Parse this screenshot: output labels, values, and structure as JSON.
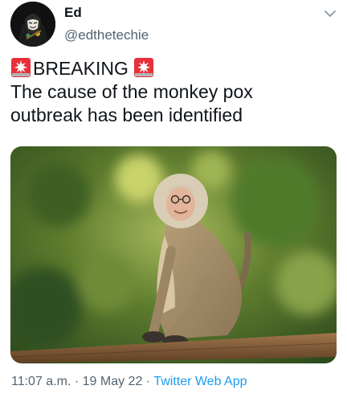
{
  "user": {
    "display_name": "Ed",
    "handle": "@edthetechie"
  },
  "tweet": {
    "line1_text": "BREAKING",
    "line2": "The cause of the monkey pox",
    "line3": "outbreak has been identified",
    "emoji": "police-car-light-emoji"
  },
  "media": {
    "subject": "monkey-photo"
  },
  "meta": {
    "time": "11:07 a.m.",
    "separator1": " · ",
    "date": "19 May 22",
    "separator2": " · ",
    "source": "Twitter Web App"
  },
  "icons": {
    "more": "chevron-down-icon"
  },
  "colors": {
    "text": "#0f1419",
    "secondary": "#536471",
    "link": "#1d9bf0",
    "siren_red": "#e8303a"
  }
}
